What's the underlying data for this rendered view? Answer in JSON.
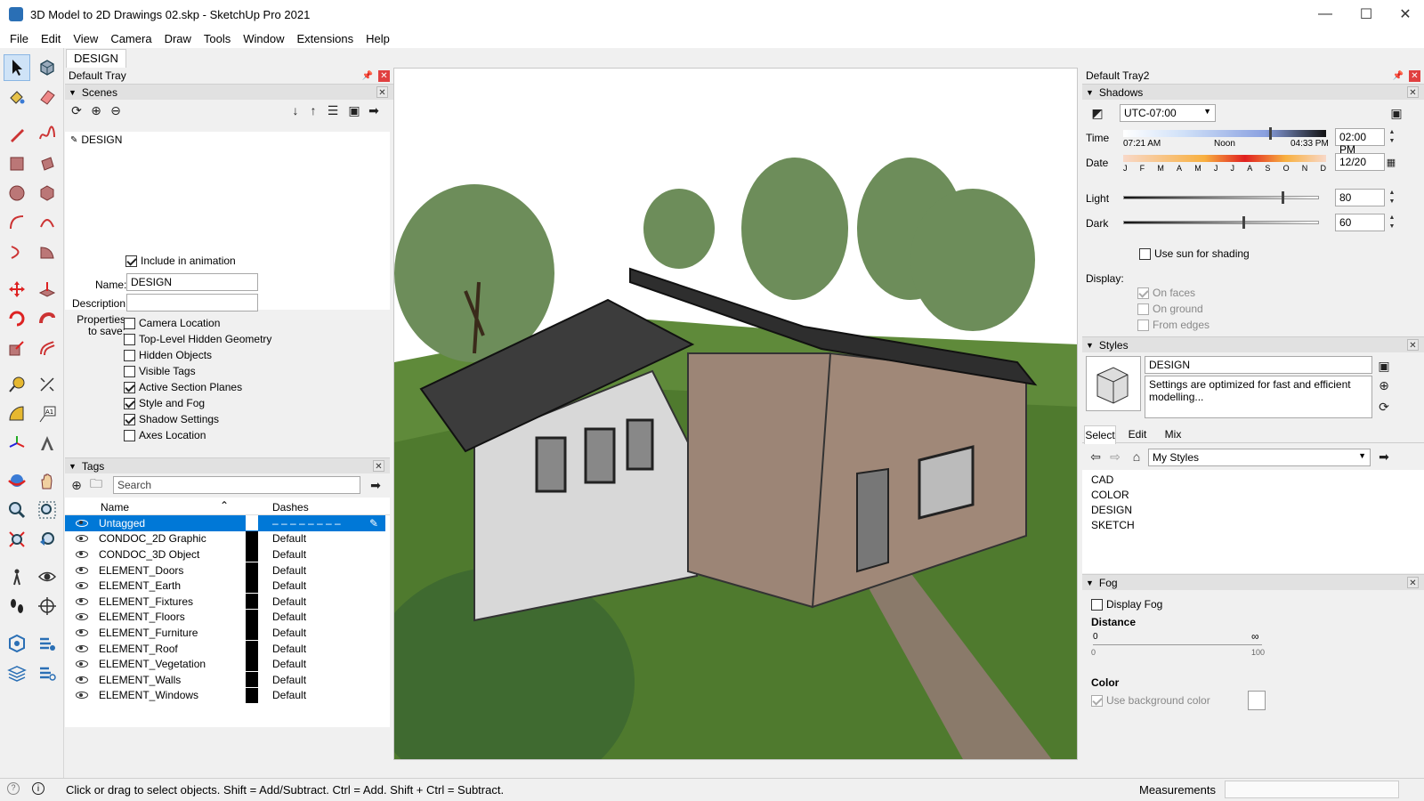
{
  "window": {
    "title": "3D Model to 2D Drawings 02.skp - SketchUp Pro 2021",
    "min": "—",
    "max": "☐",
    "close": "✕"
  },
  "menu": [
    "File",
    "Edit",
    "View",
    "Camera",
    "Draw",
    "Tools",
    "Window",
    "Extensions",
    "Help"
  ],
  "scene_tab": "DESIGN",
  "left_tray": {
    "title": "Default Tray",
    "scenes": {
      "header": "Scenes",
      "items": [
        "DESIGN"
      ],
      "include_animation": "Include in animation",
      "name_label": "Name:",
      "name_value": "DESIGN",
      "desc_label": "Description:",
      "desc_value": "",
      "props_label": "Properties to save:",
      "props": [
        {
          "label": "Camera Location",
          "checked": false
        },
        {
          "label": "Top-Level Hidden Geometry",
          "checked": false
        },
        {
          "label": "Hidden Objects",
          "checked": false
        },
        {
          "label": "Visible Tags",
          "checked": false
        },
        {
          "label": "Active Section Planes",
          "checked": true
        },
        {
          "label": "Style and Fog",
          "checked": true
        },
        {
          "label": "Shadow Settings",
          "checked": true
        },
        {
          "label": "Axes Location",
          "checked": false
        }
      ]
    },
    "tags": {
      "header": "Tags",
      "search_placeholder": "Search",
      "col_name": "Name",
      "col_dashes": "Dashes",
      "rows": [
        {
          "name": "Untagged",
          "dash": "– – – – – – – –"
        },
        {
          "name": "CONDOC_2D Graphic",
          "dash": "Default"
        },
        {
          "name": "CONDOC_3D Object",
          "dash": "Default"
        },
        {
          "name": "ELEMENT_Doors",
          "dash": "Default"
        },
        {
          "name": "ELEMENT_Earth",
          "dash": "Default"
        },
        {
          "name": "ELEMENT_Fixtures",
          "dash": "Default"
        },
        {
          "name": "ELEMENT_Floors",
          "dash": "Default"
        },
        {
          "name": "ELEMENT_Furniture",
          "dash": "Default"
        },
        {
          "name": "ELEMENT_Roof",
          "dash": "Default"
        },
        {
          "name": "ELEMENT_Vegetation",
          "dash": "Default"
        },
        {
          "name": "ELEMENT_Walls",
          "dash": "Default"
        },
        {
          "name": "ELEMENT_Windows",
          "dash": "Default"
        }
      ]
    }
  },
  "right_tray": {
    "title": "Default Tray2",
    "shadows": {
      "header": "Shadows",
      "timezone": "UTC-07:00",
      "time_label": "Time",
      "time_start": "07:21 AM",
      "time_noon": "Noon",
      "time_end": "04:33 PM",
      "time_value": "02:00 PM",
      "time_fraction": 0.72,
      "date_label": "Date",
      "months": [
        "J",
        "F",
        "M",
        "A",
        "M",
        "J",
        "J",
        "A",
        "S",
        "O",
        "N",
        "D"
      ],
      "date_value": "12/20",
      "light_label": "Light",
      "light_value": "80",
      "dark_label": "Dark",
      "dark_value": "60",
      "use_sun": "Use sun for shading",
      "display_label": "Display:",
      "on_faces": "On faces",
      "on_ground": "On ground",
      "from_edges": "From edges"
    },
    "styles": {
      "header": "Styles",
      "name": "DESIGN",
      "description": "Settings are optimized for fast and efficient modelling...",
      "tabs": [
        "Select",
        "Edit",
        "Mix"
      ],
      "library": "My Styles",
      "items": [
        "CAD",
        "COLOR",
        "DESIGN",
        "SKETCH"
      ]
    },
    "fog": {
      "header": "Fog",
      "display_fog": "Display Fog",
      "distance_label": "Distance",
      "dist_start": "0",
      "dist_end": "∞",
      "dist_min": "0",
      "dist_max": "100",
      "color_label": "Color",
      "use_bg": "Use background color"
    }
  },
  "status": {
    "hint": "Click or drag to select objects. Shift = Add/Subtract. Ctrl = Add. Shift + Ctrl = Subtract.",
    "measurements": "Measurements",
    "info": "i"
  }
}
